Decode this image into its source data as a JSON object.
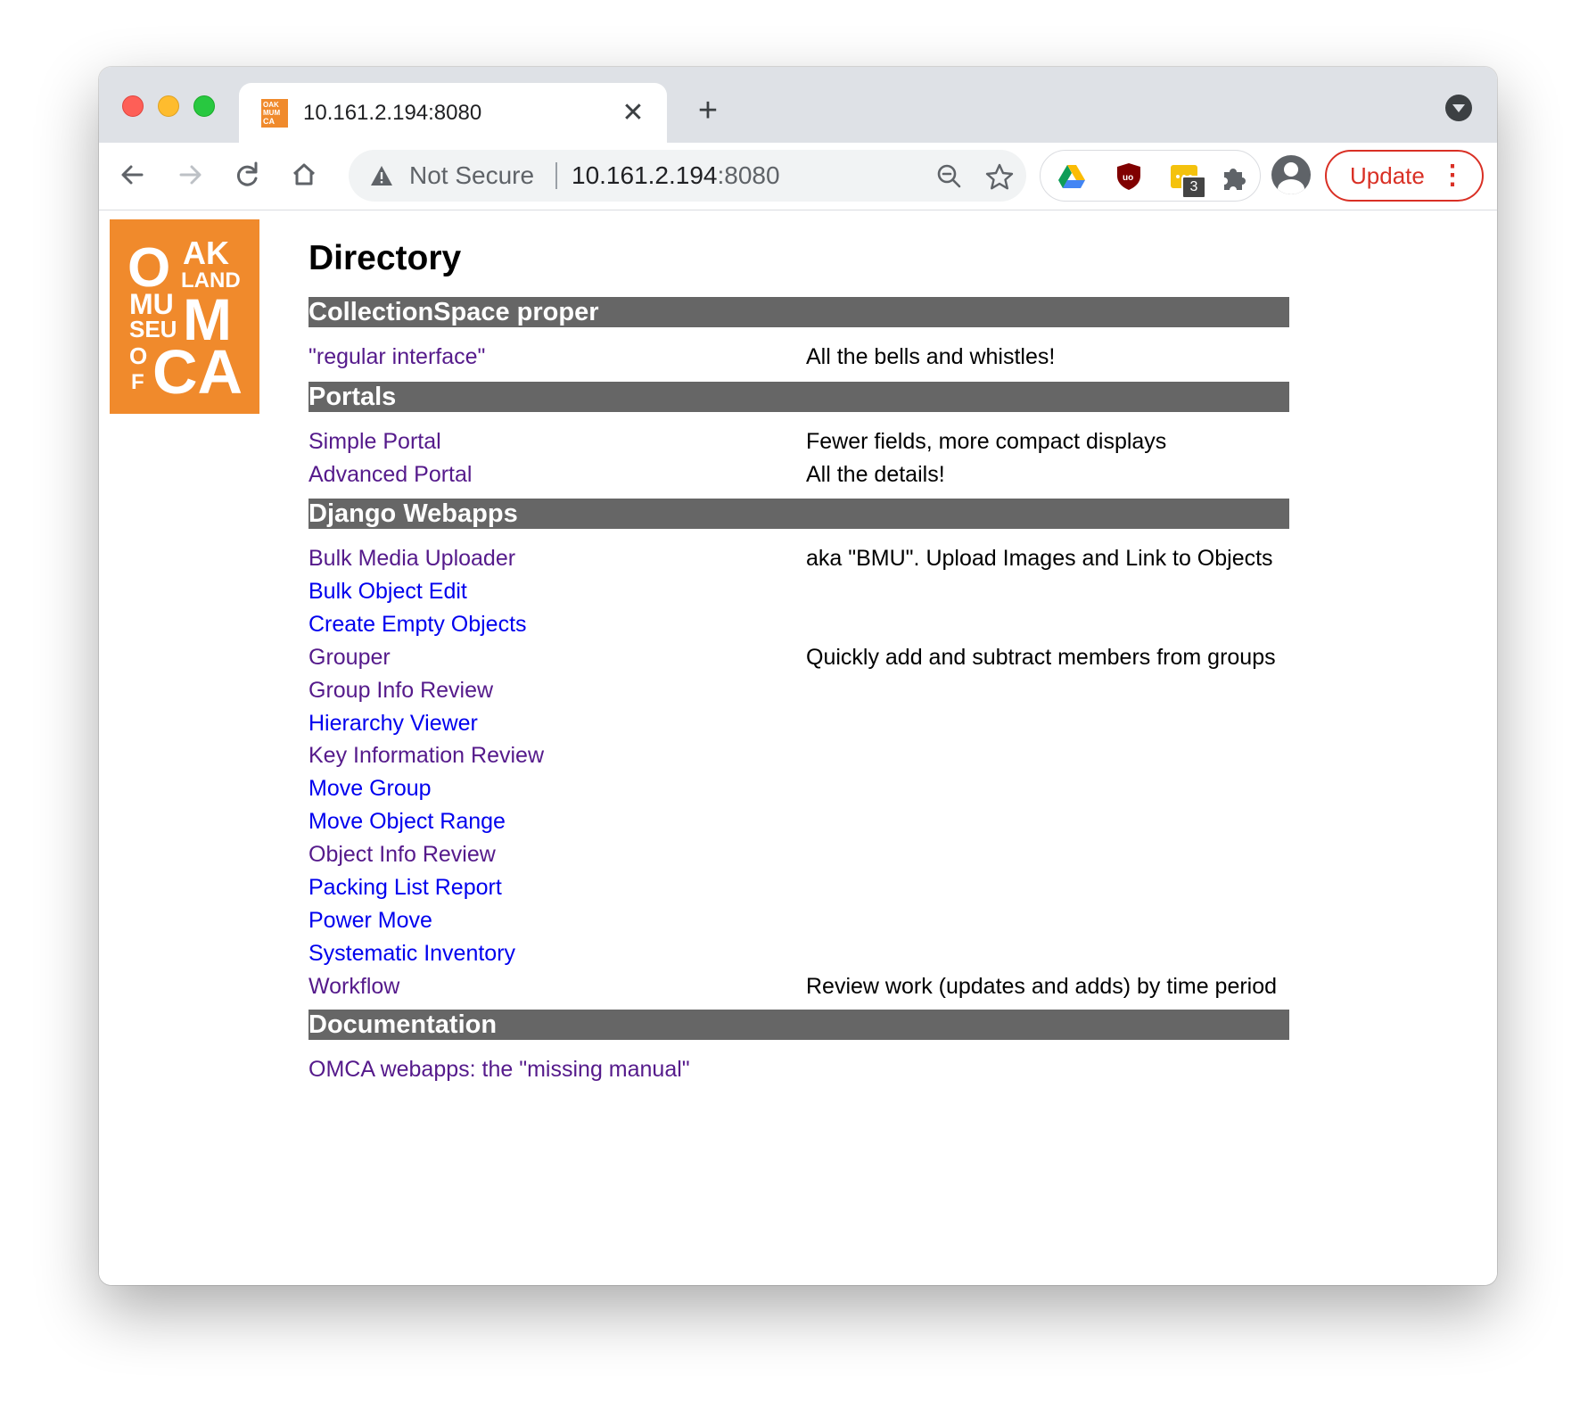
{
  "browser": {
    "tab": {
      "title": "10.161.2.194:8080",
      "favicon_text": "OAK LAND MU SEU M OF CA"
    },
    "omnibox": {
      "security_label": "Not Secure",
      "url_host": "10.161.2.194",
      "url_port": ":8080"
    },
    "extensions": {
      "badge_count": "3"
    },
    "update_label": "Update",
    "icons": {
      "back": "back-arrow-icon",
      "forward": "forward-arrow-icon",
      "reload": "reload-icon",
      "home": "home-icon",
      "zoom": "zoom-out-icon",
      "bookmark": "star-icon"
    }
  },
  "page": {
    "logo_text": [
      "OAK",
      "LAND",
      "MU",
      "SEU",
      "M",
      "O",
      "F",
      "CA"
    ],
    "title": "Directory",
    "colors": {
      "section_bar": "#666666",
      "visited_link": "#551a8b",
      "unvisited_link": "#0000ee",
      "logo": "#f08a2c"
    },
    "sections": [
      {
        "heading": "CollectionSpace proper",
        "items": [
          {
            "label": "\"regular interface\"",
            "desc": "All the bells and whistles!",
            "visited": true
          }
        ]
      },
      {
        "heading": "Portals",
        "items": [
          {
            "label": "Simple Portal",
            "desc": "Fewer fields, more compact displays",
            "visited": true
          },
          {
            "label": "Advanced Portal",
            "desc": "All the details!",
            "visited": true
          }
        ]
      },
      {
        "heading": "Django Webapps",
        "items": [
          {
            "label": "Bulk Media Uploader",
            "desc": "aka \"BMU\". Upload Images and Link to Objects",
            "visited": true
          },
          {
            "label": "Bulk Object Edit",
            "desc": "",
            "visited": false
          },
          {
            "label": "Create Empty Objects",
            "desc": "",
            "visited": false
          },
          {
            "label": "Grouper",
            "desc": "Quickly add and subtract members from groups",
            "visited": true
          },
          {
            "label": "Group Info Review",
            "desc": "",
            "visited": true
          },
          {
            "label": "Hierarchy Viewer",
            "desc": "",
            "visited": false
          },
          {
            "label": "Key Information Review",
            "desc": "",
            "visited": true
          },
          {
            "label": "Move Group",
            "desc": "",
            "visited": false
          },
          {
            "label": "Move Object Range",
            "desc": "",
            "visited": false
          },
          {
            "label": "Object Info Review",
            "desc": "",
            "visited": true
          },
          {
            "label": "Packing List Report",
            "desc": "",
            "visited": false
          },
          {
            "label": "Power Move",
            "desc": "",
            "visited": false
          },
          {
            "label": "Systematic Inventory",
            "desc": "",
            "visited": false
          },
          {
            "label": "Workflow",
            "desc": "Review work (updates and adds) by time period",
            "visited": true
          }
        ]
      },
      {
        "heading": "Documentation",
        "items": [
          {
            "label": "OMCA webapps: the \"missing manual\"",
            "desc": "",
            "visited": true
          }
        ]
      }
    ]
  }
}
